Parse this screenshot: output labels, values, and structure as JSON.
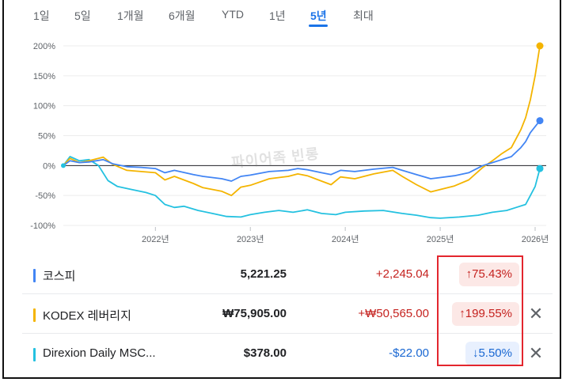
{
  "tabs": [
    "1일",
    "5일",
    "1개월",
    "6개월",
    "YTD",
    "1년",
    "5년",
    "최대"
  ],
  "active_tab": "5년",
  "watermark": "파이어족 빈롱",
  "colors": {
    "kospi": "#4285f4",
    "kodex": "#f4b400",
    "direxion": "#24c1e0",
    "up_text": "#c5221f",
    "down_text": "#1967d2",
    "highlight": "#e3262e"
  },
  "rows": [
    {
      "name": "코스피",
      "price": "5,221.25",
      "change": "+2,245.04",
      "percent": "↑75.43%",
      "direction": "up",
      "removable": false,
      "color": "#4285f4"
    },
    {
      "name": "KODEX 레버리지",
      "price": "₩75,905.00",
      "change": "+₩50,565.00",
      "percent": "↑199.55%",
      "direction": "up",
      "removable": true,
      "color": "#f4b400"
    },
    {
      "name": "Direxion Daily MSC...",
      "price": "$378.00",
      "change": "-$22.00",
      "percent": "↓5.50%",
      "direction": "down",
      "removable": true,
      "color": "#24c1e0"
    }
  ],
  "chart_data": {
    "type": "line",
    "y_ticks": [
      "200%",
      "150%",
      "100%",
      "50%",
      "0%",
      "-50%",
      "-100%"
    ],
    "y_tick_values": [
      200,
      150,
      100,
      50,
      0,
      -50,
      -100
    ],
    "x_ticks": [
      "2022년",
      "2023년",
      "2024년",
      "2025년",
      "2026년"
    ],
    "x_tick_values": [
      2022,
      2023,
      2024,
      2025,
      2026
    ],
    "xlim": [
      2021.03,
      2026.05
    ],
    "ylim": [
      -100,
      200
    ],
    "baseline": 0,
    "series": [
      {
        "name": "코스피",
        "color": "#4285f4",
        "points": [
          [
            2021.03,
            0
          ],
          [
            2021.1,
            8
          ],
          [
            2021.2,
            5
          ],
          [
            2021.3,
            6
          ],
          [
            2021.45,
            10
          ],
          [
            2021.55,
            3
          ],
          [
            2021.7,
            -2
          ],
          [
            2021.85,
            -3
          ],
          [
            2022.0,
            -5
          ],
          [
            2022.1,
            -12
          ],
          [
            2022.2,
            -8
          ],
          [
            2022.4,
            -15
          ],
          [
            2022.5,
            -18
          ],
          [
            2022.7,
            -22
          ],
          [
            2022.8,
            -26
          ],
          [
            2022.9,
            -18
          ],
          [
            2023.0,
            -16
          ],
          [
            2023.2,
            -10
          ],
          [
            2023.4,
            -8
          ],
          [
            2023.5,
            -5
          ],
          [
            2023.6,
            -7
          ],
          [
            2023.75,
            -12
          ],
          [
            2023.85,
            -15
          ],
          [
            2023.95,
            -8
          ],
          [
            2024.1,
            -10
          ],
          [
            2024.3,
            -6
          ],
          [
            2024.5,
            -3
          ],
          [
            2024.6,
            -8
          ],
          [
            2024.75,
            -15
          ],
          [
            2024.9,
            -22
          ],
          [
            2025.0,
            -20
          ],
          [
            2025.15,
            -17
          ],
          [
            2025.3,
            -12
          ],
          [
            2025.45,
            0
          ],
          [
            2025.55,
            5
          ],
          [
            2025.65,
            10
          ],
          [
            2025.75,
            15
          ],
          [
            2025.85,
            30
          ],
          [
            2025.9,
            40
          ],
          [
            2025.95,
            55
          ],
          [
            2026.0,
            65
          ],
          [
            2026.05,
            75
          ]
        ]
      },
      {
        "name": "KODEX 레버리지",
        "color": "#f4b400",
        "points": [
          [
            2021.03,
            0
          ],
          [
            2021.1,
            12
          ],
          [
            2021.2,
            5
          ],
          [
            2021.3,
            8
          ],
          [
            2021.45,
            14
          ],
          [
            2021.55,
            2
          ],
          [
            2021.7,
            -8
          ],
          [
            2021.85,
            -10
          ],
          [
            2022.0,
            -12
          ],
          [
            2022.1,
            -24
          ],
          [
            2022.2,
            -18
          ],
          [
            2022.4,
            -30
          ],
          [
            2022.5,
            -37
          ],
          [
            2022.7,
            -43
          ],
          [
            2022.8,
            -50
          ],
          [
            2022.9,
            -36
          ],
          [
            2023.0,
            -33
          ],
          [
            2023.2,
            -22
          ],
          [
            2023.4,
            -18
          ],
          [
            2023.5,
            -14
          ],
          [
            2023.6,
            -17
          ],
          [
            2023.75,
            -26
          ],
          [
            2023.85,
            -32
          ],
          [
            2023.95,
            -19
          ],
          [
            2024.1,
            -22
          ],
          [
            2024.3,
            -14
          ],
          [
            2024.5,
            -8
          ],
          [
            2024.6,
            -18
          ],
          [
            2024.75,
            -32
          ],
          [
            2024.9,
            -44
          ],
          [
            2025.0,
            -40
          ],
          [
            2025.15,
            -34
          ],
          [
            2025.3,
            -24
          ],
          [
            2025.45,
            -3
          ],
          [
            2025.55,
            8
          ],
          [
            2025.65,
            20
          ],
          [
            2025.75,
            30
          ],
          [
            2025.85,
            60
          ],
          [
            2025.9,
            80
          ],
          [
            2025.95,
            110
          ],
          [
            2026.0,
            150
          ],
          [
            2026.05,
            200
          ]
        ]
      },
      {
        "name": "Direxion Daily MSC...",
        "color": "#24c1e0",
        "points": [
          [
            2021.03,
            0
          ],
          [
            2021.1,
            15
          ],
          [
            2021.2,
            8
          ],
          [
            2021.3,
            10
          ],
          [
            2021.4,
            0
          ],
          [
            2021.5,
            -25
          ],
          [
            2021.6,
            -35
          ],
          [
            2021.75,
            -40
          ],
          [
            2021.9,
            -45
          ],
          [
            2022.0,
            -50
          ],
          [
            2022.1,
            -65
          ],
          [
            2022.2,
            -70
          ],
          [
            2022.3,
            -68
          ],
          [
            2022.45,
            -75
          ],
          [
            2022.6,
            -80
          ],
          [
            2022.75,
            -85
          ],
          [
            2022.9,
            -86
          ],
          [
            2023.0,
            -82
          ],
          [
            2023.15,
            -78
          ],
          [
            2023.3,
            -75
          ],
          [
            2023.45,
            -78
          ],
          [
            2023.6,
            -74
          ],
          [
            2023.75,
            -80
          ],
          [
            2023.9,
            -82
          ],
          [
            2024.0,
            -78
          ],
          [
            2024.2,
            -76
          ],
          [
            2024.4,
            -75
          ],
          [
            2024.6,
            -80
          ],
          [
            2024.75,
            -83
          ],
          [
            2024.9,
            -87
          ],
          [
            2025.0,
            -88
          ],
          [
            2025.2,
            -86
          ],
          [
            2025.4,
            -83
          ],
          [
            2025.55,
            -78
          ],
          [
            2025.7,
            -75
          ],
          [
            2025.8,
            -70
          ],
          [
            2025.9,
            -65
          ],
          [
            2025.95,
            -50
          ],
          [
            2026.0,
            -35
          ],
          [
            2026.05,
            -5
          ]
        ]
      }
    ]
  }
}
